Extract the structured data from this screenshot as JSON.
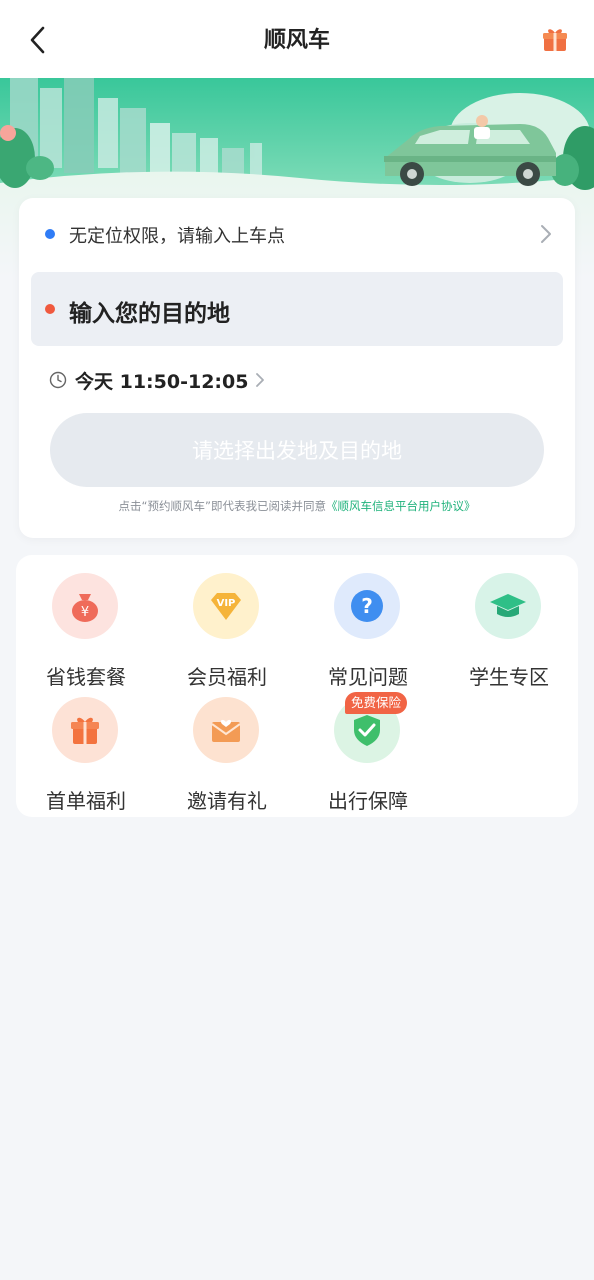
{
  "header": {
    "title": "顺风车",
    "back_icon": "chevron-left-icon",
    "gift_icon": "gift-icon"
  },
  "trip": {
    "pickup_text": "无定位权限，请输入上车点",
    "destination_placeholder": "输入您的目的地",
    "time_text": "今天 11:50-12:05",
    "submit_label": "请选择出发地及目的地",
    "agreement_prefix": "点击“预约顺风车”即代表我已阅读并同意",
    "agreement_link": "《顺风车信息平台用户协议》"
  },
  "services": [
    {
      "label": "省钱套餐",
      "icon": "money-bag-icon"
    },
    {
      "label": "会员福利",
      "icon": "vip-diamond-icon"
    },
    {
      "label": "常见问题",
      "icon": "question-icon"
    },
    {
      "label": "学生专区",
      "icon": "graduation-cap-icon"
    },
    {
      "label": "首单福利",
      "icon": "gift-box-icon"
    },
    {
      "label": "邀请有礼",
      "icon": "invite-envelope-icon"
    },
    {
      "label": "出行保障",
      "icon": "shield-check-icon",
      "badge": "免费保险"
    }
  ],
  "colors": {
    "accent_green": "#1fb27b",
    "pickup_dot": "#2f7cf6",
    "dest_dot": "#f0593e",
    "badge": "#f16445"
  }
}
